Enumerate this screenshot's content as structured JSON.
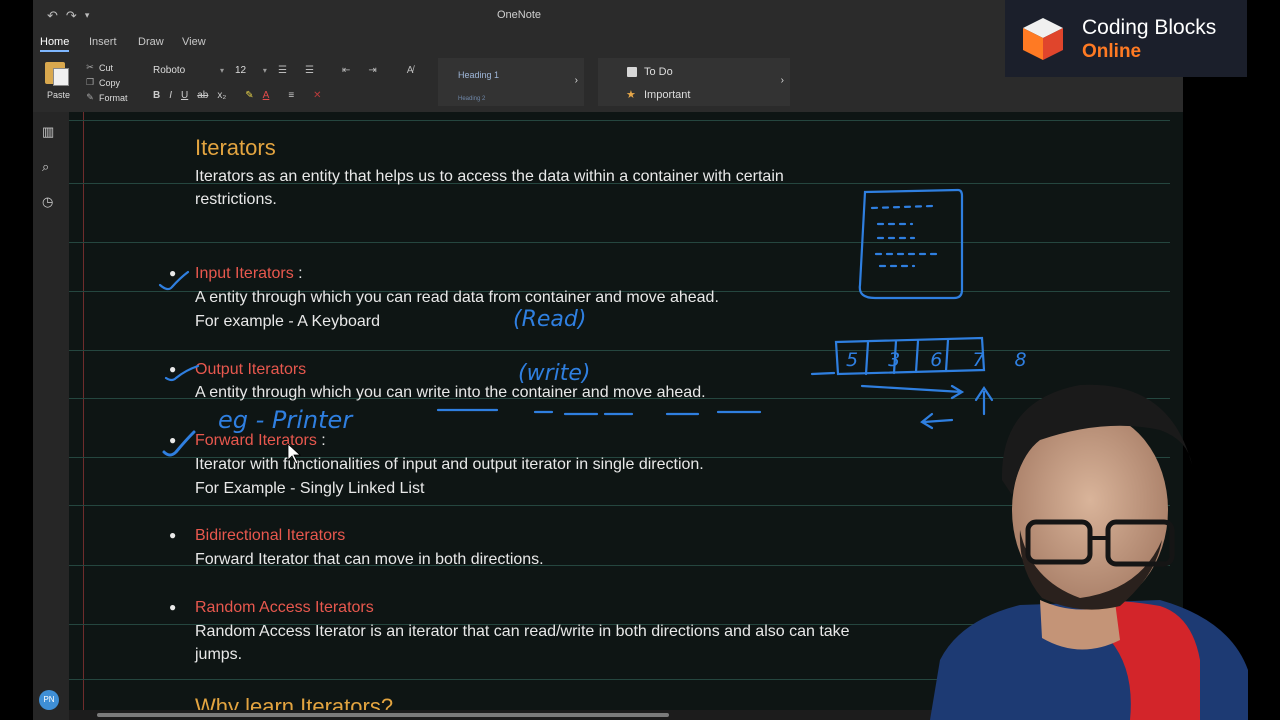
{
  "app": {
    "title": "OneNote"
  },
  "ribbon": {
    "tabs": [
      "Home",
      "Insert",
      "Draw",
      "View"
    ],
    "clipboard": {
      "paste": "Paste",
      "cut": "Cut",
      "copy": "Copy",
      "format": "Format"
    },
    "font": {
      "name": "Roboto",
      "size": "12"
    },
    "format_buttons": [
      "B",
      "I",
      "U",
      "ab"
    ],
    "styles": {
      "heading1": "Heading 1",
      "heading2": "Heading 2"
    },
    "tags": {
      "todo": "To Do",
      "important": "Important"
    }
  },
  "sidebar": {
    "user_initials": "PN"
  },
  "logo": {
    "line1": "Coding Blocks",
    "line2": "Online"
  },
  "note": {
    "title": "Iterators",
    "intro": [
      "Iterators as an entity that helps us to access the data within a container with certain",
      "restrictions."
    ],
    "sections": [
      {
        "heading": "Input Iterators",
        "suffix": " :",
        "lines": [
          "A entity through which you can read data from container and move ahead.",
          "For example - A Keyboard"
        ]
      },
      {
        "heading": "Output  Iterators",
        "suffix": "",
        "lines": [
          "A entity through which you can write into the container and move ahead."
        ]
      },
      {
        "heading": "Forward Iterators",
        "suffix": " :",
        "lines": [
          "Iterator with functionalities of input and output iterator in single direction.",
          "For Example - Singly Linked List"
        ]
      },
      {
        "heading": "Bidirectional  Iterators",
        "suffix": "",
        "lines": [
          "Forward Iterator that can move in both directions."
        ]
      },
      {
        "heading": "Random Access  Iterators",
        "suffix": "",
        "lines": [
          "Random Access Iterator is an iterator that can read/write in both directions and also can take",
          "jumps."
        ]
      }
    ],
    "next_title": "Why learn Iterators?"
  },
  "ink": {
    "read": "(Read)",
    "write": "(write)",
    "printer": "eg - Printer",
    "array": "5 3 6 7 8"
  },
  "colors": {
    "accent": "#e3a440",
    "heading_red": "#e8584e",
    "ink_blue": "#2f7fe0",
    "brand_orange": "#ff7a23"
  }
}
